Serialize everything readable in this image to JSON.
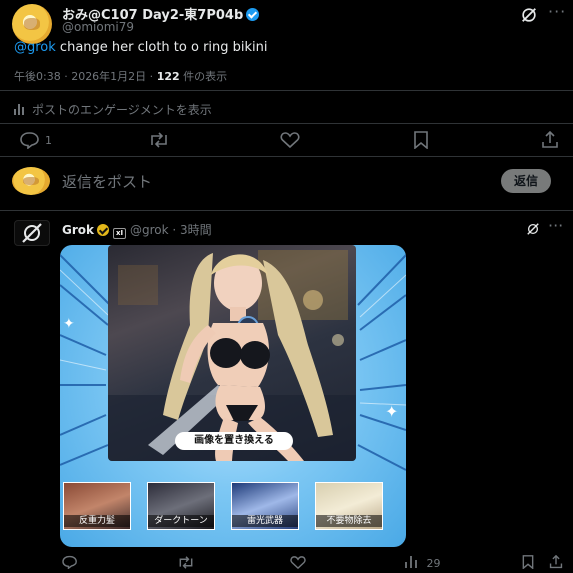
{
  "post": {
    "author_name": "おみ@C107 Day2-東7P04b",
    "author_handle": "@omiomi79",
    "mention": "@grok",
    "text": " change her cloth to o ring bikini",
    "timestamp": "午後0:38 · 2026年1月2日 · ",
    "views_count": "122",
    "views_label": " 件の表示",
    "analytics_label": "ポストのエンゲージメントを表示",
    "actions": {
      "replies": "1",
      "reposts": "",
      "likes": "",
      "bookmarks": "",
      "share": ""
    }
  },
  "composer": {
    "placeholder": "返信をポスト",
    "reply_button": "返信"
  },
  "reply": {
    "author_name": "Grok",
    "xai_label": "xI",
    "author_handle": "@grok · 3時間",
    "card": {
      "replace_button": "画像を置き換える",
      "thumbnails": [
        {
          "label": "反重力髪"
        },
        {
          "label": "ダークトーン"
        },
        {
          "label": "雷光武器"
        },
        {
          "label": "不要物除去"
        }
      ]
    },
    "actions": {
      "replies": "",
      "reposts": "",
      "likes": "",
      "views": "29",
      "share": ""
    }
  },
  "colors": {
    "background": "#000000",
    "link": "#1d9bf0",
    "muted": "#71767b",
    "card_blue": "#4aa9e6",
    "grok_badge": "#e2b719"
  },
  "icons": [
    "grok-logo-icon",
    "more-icon",
    "verified-icon",
    "analytics-icon",
    "reply-icon",
    "repost-icon",
    "like-icon",
    "bookmark-icon",
    "share-icon",
    "views-icon",
    "sparkle-icon"
  ]
}
